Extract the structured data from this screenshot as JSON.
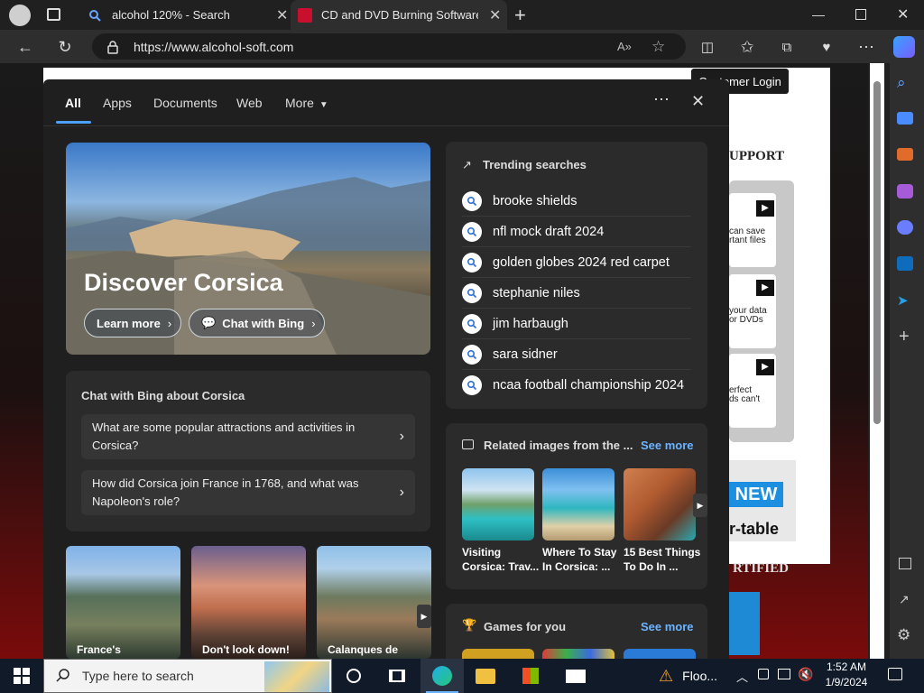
{
  "browser": {
    "tabs": [
      {
        "title": "alcohol 120% - Search"
      },
      {
        "title": "CD and DVD Burning Software -"
      }
    ],
    "url": "https://www.alcohol-soft.com"
  },
  "site": {
    "login_label": "Customer Login",
    "support_label": "UPPORT",
    "certified_label": "RTIFIED",
    "promo1": "can save\nrtant files",
    "promo2": "your data\nor DVDs",
    "promo3": "erfect\nds can't",
    "badge_new": "NEW",
    "badge_table": "r-table"
  },
  "search_panel": {
    "tabs": [
      "All",
      "Apps",
      "Documents",
      "Web",
      "More"
    ],
    "active_tab": "All",
    "hero": {
      "title": "Discover Corsica",
      "learn_more": "Learn more",
      "chat_with_bing": "Chat with Bing"
    },
    "chat_card": {
      "heading": "Chat with Bing about Corsica",
      "suggestions": [
        "What are some popular attractions and activities in Corsica?",
        "How did Corsica join France in 1768, and what was Napoleon's role?"
      ]
    },
    "thumbs": [
      "France's",
      "Don't look down!",
      "Calanques de"
    ],
    "trending": {
      "heading": "Trending searches",
      "items": [
        "brooke shields",
        "nfl mock draft 2024",
        "golden globes 2024 red carpet",
        "stephanie niles",
        "jim harbaugh",
        "sara sidner",
        "ncaa football championship 2024"
      ]
    },
    "related": {
      "heading": "Related images from the ...",
      "see_more": "See more",
      "items": [
        {
          "line1": "Visiting",
          "line2": "Corsica: Trav..."
        },
        {
          "line1": "Where To Stay",
          "line2": "In Corsica: ..."
        },
        {
          "line1": "15 Best Things",
          "line2": "To Do In ..."
        }
      ]
    },
    "games": {
      "heading": "Games for you",
      "see_more": "See more"
    }
  },
  "taskbar": {
    "search_placeholder": "Type here to search",
    "weather_text": "Floo...",
    "time": "1:52 AM",
    "date": "1/9/2024"
  }
}
